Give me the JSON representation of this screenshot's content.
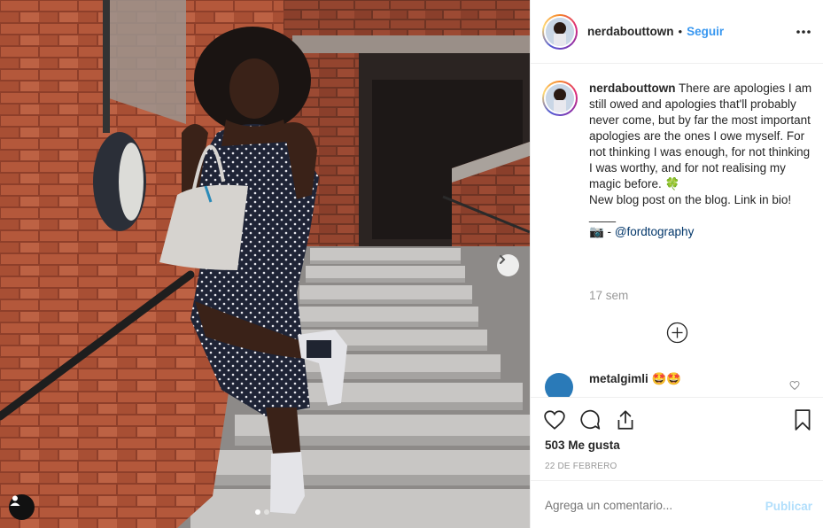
{
  "post": {
    "username": "nerdabouttown",
    "separator": "•",
    "follow_label": "Seguir",
    "more_icon": "more-horizontal-icon"
  },
  "caption": {
    "username": "nerdabouttown",
    "line1": " There are apologies I am still owed and apologies that'll probably never come, but by far the most important apologies are the ones I owe myself. For not thinking I was enough, for not thinking I was worthy, and for not realising my magic before. 🍀",
    "line2": "New blog post on the blog. Link in bio!",
    "line3": "____",
    "credit_prefix": "📷 - ",
    "mention": "@fordtography",
    "time_ago": "17 sem"
  },
  "comments": [
    {
      "username": "metalgimli",
      "text": "🤩🤩"
    }
  ],
  "actions": {
    "likes": "503 Me gusta",
    "date": "22 DE FEBRERO"
  },
  "add_comment": {
    "placeholder": "Agrega un comentario...",
    "post_label": "Publicar"
  },
  "colors": {
    "link_blue": "#3897f0",
    "mention_blue": "#003569",
    "muted_gray": "#999999",
    "disabled_post": "#b2dffc"
  },
  "carousel": {
    "slides": 2,
    "active": 1
  }
}
